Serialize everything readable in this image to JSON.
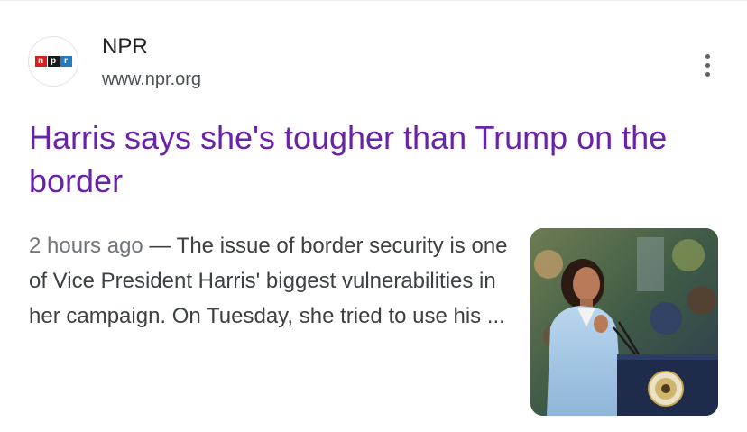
{
  "source": {
    "name": "NPR",
    "url": "www.npr.org",
    "logo_letters": [
      "n",
      "p",
      "r"
    ]
  },
  "article": {
    "title": "Harris says she's tougher than Trump on the border",
    "time": "2 hours ago",
    "separator": " — ",
    "snippet": "The issue of border security is one of Vice President Harris' biggest vulnerabilities in her campaign. On Tuesday, she tried to use his ...",
    "thumbnail_icon": "photo-harris-at-podium"
  },
  "menu": {
    "icon": "more-vert-icon"
  },
  "colors": {
    "title": "#6a23a6",
    "source_text": "#202124",
    "url_text": "#4d5156",
    "snippet_text": "#3c4043",
    "npr_red": "#d62021",
    "npr_black": "#1a1a1a",
    "npr_blue": "#237bbd"
  }
}
